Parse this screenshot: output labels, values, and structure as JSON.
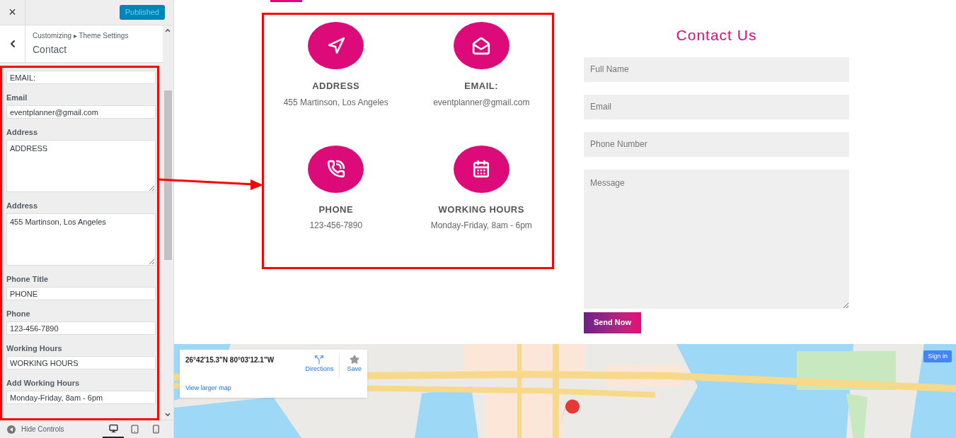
{
  "sidebar": {
    "close": "×",
    "publish_button": "Published",
    "breadcrumb": "Customizing ▸ Theme Settings",
    "section_title": "Contact",
    "fields": [
      {
        "kind": "input",
        "value": "EMAIL:"
      },
      {
        "kind": "input",
        "label": "Email",
        "value": "eventplanner@gmail.com"
      },
      {
        "kind": "textarea",
        "label": "Address",
        "value": "ADDRESS"
      },
      {
        "kind": "textarea",
        "label": "Address",
        "value": "455 Martinson, Los Angeles"
      },
      {
        "kind": "input",
        "label": "Phone Title",
        "value": "PHONE"
      },
      {
        "kind": "input",
        "label": "Phone",
        "value": "123-456-7890"
      },
      {
        "kind": "input",
        "label": "Working Hours",
        "value": "WORKING HOURS"
      },
      {
        "kind": "input",
        "label": "Add Working Hours",
        "value": "Monday-Friday, 8am - 6pm"
      }
    ],
    "hide_controls": "Hide Controls",
    "devices": [
      {
        "kind": "desktop",
        "selected": true
      },
      {
        "kind": "tablet",
        "selected": false
      },
      {
        "kind": "mobile",
        "selected": false
      }
    ]
  },
  "contact_items": [
    {
      "kind": "address",
      "title": "ADDRESS",
      "text": "455 Martinson, Los Angeles"
    },
    {
      "kind": "email",
      "title": "EMAIL:",
      "text": "eventplanner@gmail.com"
    },
    {
      "kind": "phone",
      "title": "PHONE",
      "text": "123-456-7890"
    },
    {
      "kind": "hours",
      "title": "WORKING HOURS",
      "text": "Monday-Friday, 8am - 6pm"
    }
  ],
  "form": {
    "title": "Contact Us",
    "fields": [
      {
        "kind": "input",
        "placeholder": "Full Name"
      },
      {
        "kind": "input",
        "placeholder": "Email"
      },
      {
        "kind": "input",
        "placeholder": "Phone Number"
      },
      {
        "kind": "textarea",
        "placeholder": "Message"
      }
    ],
    "submit": "Send Now"
  },
  "map": {
    "kind": "picture",
    "coordinates": "26°42'15.3\"N 80°03'12.1\"W",
    "directions": "Directions",
    "save": "Save",
    "larger_map": "View larger map",
    "sign_in": "Sign in"
  }
}
